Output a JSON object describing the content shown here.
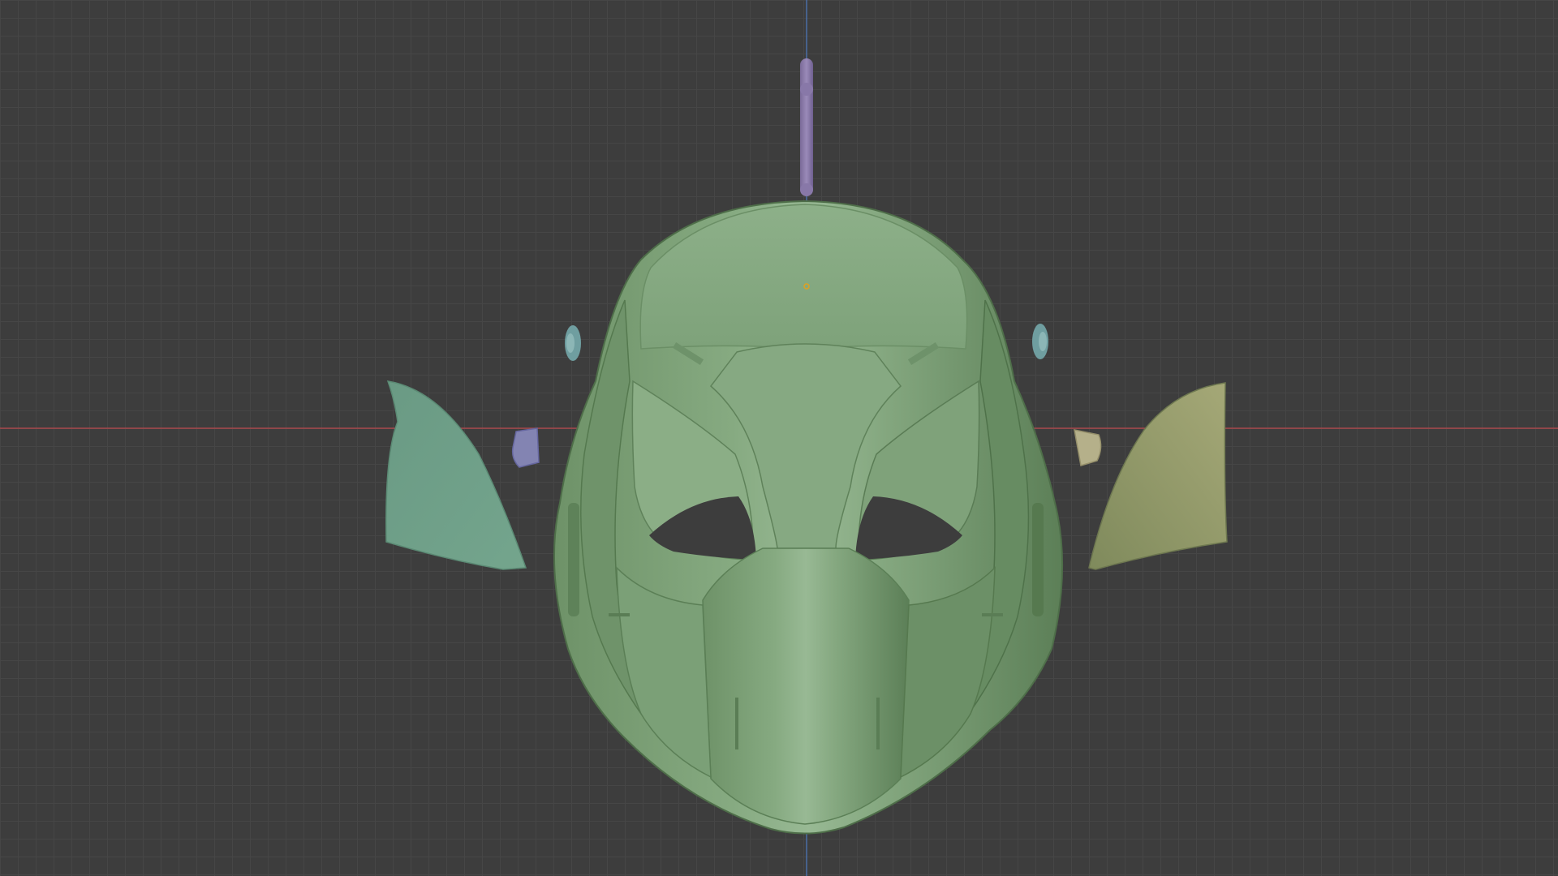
{
  "viewport": {
    "grid": true,
    "axes": {
      "x_axis_color": "#a8484c",
      "z_axis_color": "#4b6ea6"
    },
    "background_color": "#3d3d3d"
  },
  "objects": [
    {
      "name": "helmet-mask",
      "color": "#84a67f"
    },
    {
      "name": "antenna-rod",
      "color": "#8a7aa8"
    },
    {
      "name": "left-ear-fin",
      "color": "#6f9c86"
    },
    {
      "name": "right-ear-fin",
      "color": "#8d9468"
    },
    {
      "name": "left-side-clip",
      "color": "#8384b2"
    },
    {
      "name": "right-side-clip",
      "color": "#b5b08a"
    },
    {
      "name": "left-bolt",
      "color": "#6f9ea0"
    },
    {
      "name": "right-bolt",
      "color": "#6f9ea0"
    }
  ],
  "origin_marker_color": "#e0a020"
}
